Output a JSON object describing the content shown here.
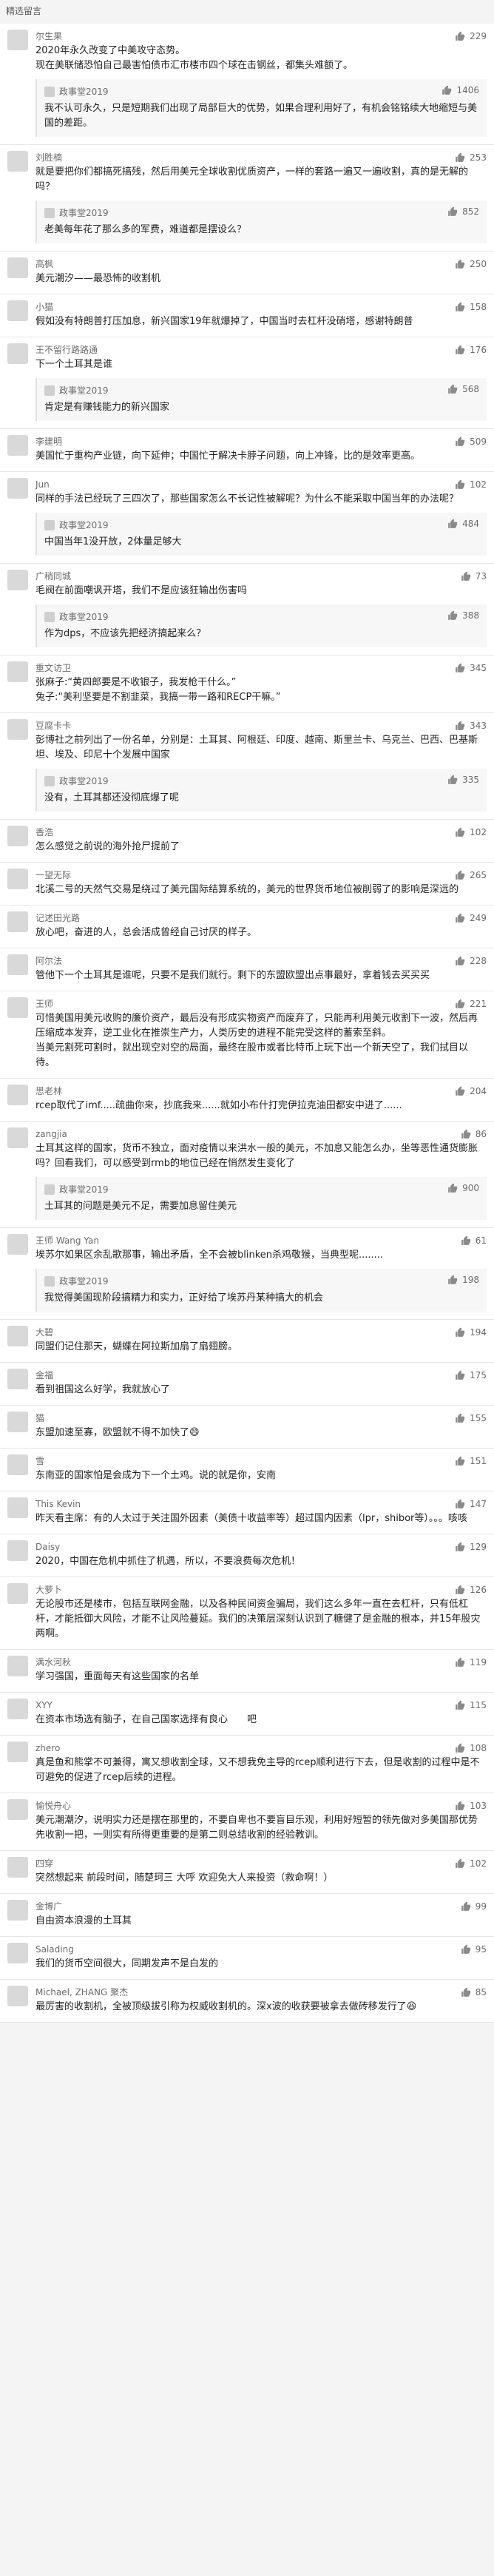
{
  "header": {
    "title": "精选留言"
  },
  "comments": [
    {
      "name": "尔生果",
      "likes": "229",
      "text": "2020年永久改变了中美攻守态势。\n现在美联储恐怕自己最害怕债市汇市楼市四个球在击钢丝，都集头难额了。",
      "reply": {
        "author": "政事堂2019",
        "likes": "1406",
        "text": "我不认可永久，只是短期我们出现了局部巨大的优势，如果合理利用好了，有机会铭铭续大地缩短与美国的差距。"
      }
    },
    {
      "name": "刘胜楠",
      "likes": "253",
      "text": "就是要把你们都搞死搞残，然后用美元全球收割优质资产，一样的套路一遍又一遍收割，真的是无解的吗？",
      "reply": {
        "author": "政事堂2019",
        "likes": "852",
        "text": "老美每年花了那么多的军费，难道都是摆设么？"
      }
    },
    {
      "name": "高枫",
      "likes": "250",
      "text": "美元潮汐——最恐怖的收割机",
      "reply": null
    },
    {
      "name": "小猫",
      "likes": "158",
      "text": "假如没有特朗普打压加息，新兴国家19年就爆掉了，中国当时去杠杆没硝塔，感谢特朗普",
      "reply": null
    },
    {
      "name": "王不留行路路通",
      "likes": "176",
      "text": "下一个土耳其是谁",
      "reply": {
        "author": "政事堂2019",
        "likes": "568",
        "text": "肯定是有赚钱能力的新兴国家"
      }
    },
    {
      "name": "李建明",
      "likes": "509",
      "text": "美国忙于重构产业链，向下延伸；中国忙于解决卡脖子问题，向上冲锋，比的是效率更高。",
      "reply": null
    },
    {
      "name": "Jun",
      "likes": "102",
      "text": "同样的手法已经玩了三四次了，那些国家怎么不长记性被解呢？为什么不能采取中国当年的办法呢？",
      "reply": {
        "author": "政事堂2019",
        "likes": "484",
        "text": "中国当年1没开放，2体量足够大"
      }
    },
    {
      "name": "广稍同城",
      "likes": "73",
      "text": "毛阀在前面嘲讽开塔，我们不是应该狂输出伤害吗",
      "reply": {
        "author": "政事堂2019",
        "likes": "388",
        "text": "作为dps，不应该先把经济搞起来么？"
      }
    },
    {
      "name": "重文访卫",
      "likes": "345",
      "text": "张麻子:“黄四郎要是不收银子，我发枪干什么。”\n兔子:“美利坚要是不割韭菜，我搞一带一路和RECP干嘛。”",
      "reply": null
    },
    {
      "name": "豆腐卡卡",
      "likes": "343",
      "text": "彭博社之前列出了一份名单，分别是：土耳其、阿根廷、印度、越南、斯里兰卡、乌克兰、巴西、巴基斯坦、埃及、印尼十个发展中国家",
      "reply": {
        "author": "政事堂2019",
        "likes": "335",
        "text": "没有，土耳其都还没彻底爆了呢"
      }
    },
    {
      "name": "香浩",
      "likes": "102",
      "text": "怎么感觉之前说的海外抢尸提前了",
      "reply": null
    },
    {
      "name": "一望无际",
      "likes": "265",
      "text": "北溪二号的天然气交易是绕过了美元国际结算系统的，美元的世界货币地位被削弱了的影响是深远的",
      "reply": null
    },
    {
      "name": "记述田光路",
      "likes": "249",
      "text": "放心吧，奋进的人，总会活成曾经自己讨厌的样子。",
      "reply": null
    },
    {
      "name": "阿尔法",
      "likes": "228",
      "text": "管他下一个土耳其是谁呢，只要不是我们就行。剩下的东盟欧盟出点事最好，拿着钱去买买买",
      "reply": null
    },
    {
      "name": "王师",
      "likes": "221",
      "text": "可惜美国用美元收购的廉价资产，最后没有形成实物资产而废弃了，只能再利用美元收割下一波，然后再压缩成本发弃，逆工业化在推崇生产力，人类历史的进程不能完受这样的蓄索至斜。\n当美元割死可割时，就出现空对空的局面，最终在股市或者比特币上玩下出一个新天空了，我们拭目以待。",
      "reply": null
    },
    {
      "name": "思老林",
      "likes": "204",
      "text": "rcep取代了imf.....疏曲你来，抄底我来......就如小布什打完伊拉克油田都安中进了......",
      "reply": null
    },
    {
      "name": "zangjia",
      "likes": "86",
      "text": "土耳其这样的国家，货币不独立，面对疫情以来洪水一般的美元，不加息又能怎么办，坐等恶性通货膨胀吗？回看我们，可以感受到rmb的地位已经在悄然发生变化了",
      "reply": {
        "author": "政事堂2019",
        "likes": "900",
        "text": "土耳其的问题是美元不足，需要加息留住美元"
      }
    },
    {
      "name": "王师 Wang Yan",
      "likes": "61",
      "text": "埃苏尔如果区余乱歌那事，输出矛盾，全不会被blinken杀鸡敬猴，当典型呢........",
      "reply": {
        "author": "政事堂2019",
        "likes": "198",
        "text": "我觉得美国现阶段搞精力和实力，正好给了埃苏丹某种搞大的机会"
      }
    },
    {
      "name": "大碧",
      "likes": "194",
      "text": "同盟们记住那天，蝴蝶在阿拉斯加扇了扇翅膀。",
      "reply": null
    },
    {
      "name": "金福",
      "likes": "175",
      "text": "看到祖国这么好学，我就放心了",
      "reply": null
    },
    {
      "name": "猫",
      "likes": "155",
      "text": "东盟加速至寡，欧盟就不得不加快了😄",
      "reply": null
    },
    {
      "name": "雪",
      "likes": "151",
      "text": "东南亚的国家怕是会成为下一个土鸡。说的就是你，安南",
      "reply": null
    },
    {
      "name": "This Kevin",
      "likes": "147",
      "text": "昨天看主席：有的人太过于关注国外因素（美债十收益率等）超过国内因素（lpr，shibor等）。。。咳咳",
      "reply": null
    },
    {
      "name": "Daisy",
      "likes": "129",
      "text": "2020，中国在危机中抓住了机遇，所以，不要浪费每次危机！",
      "reply": null
    },
    {
      "name": "大萝卜",
      "likes": "126",
      "text": "无论股市还是楼市，包括互联网金融，以及各种民间资金骗局，我们这么多年一直在去杠杆，只有低杠杆，才能抵御大风险，才能不让风险蔓延。我们的决策层深刻认识到了糖健了是金融的根本，并15年股灾两啊。",
      "reply": null
    },
    {
      "name": "满水河秋",
      "likes": "119",
      "text": "学习强国，重面每天有这些国家的名单",
      "reply": null
    },
    {
      "name": "XYY",
      "likes": "115",
      "text": "在资本市场选有脑子，在自己国家选择有良心　　吧",
      "reply": null
    },
    {
      "name": "zhero",
      "likes": "108",
      "text": "真是鱼和熊掌不可兼得，寓又想收割全球，又不想我免主导的rcep顺利进行下去，但是收割的过程中是不可避免的促进了rcep后续的进程。",
      "reply": null
    },
    {
      "name": "愉悦舟心",
      "likes": "103",
      "text": "美元潮潮汐，说明实力还是摆在那里的，不要自卑也不要盲目乐观，利用好短暂的领先做对多美国那优势先收割一把，一则实有所得更重要的是第二则总结收割的经验教训。",
      "reply": null
    },
    {
      "name": "四穿",
      "likes": "102",
      "text": "突然想起来 前段时间，随楚珂三 大呼 欢迎免大人来投资（救命啊！）",
      "reply": null
    },
    {
      "name": "金博广",
      "likes": "99",
      "text": "自由资本浪漫的土耳其",
      "reply": null
    },
    {
      "name": "Salading",
      "likes": "95",
      "text": "我们的货币空间很大，同期发声不是白发的",
      "reply": null
    },
    {
      "name": "Michael, ZHANG 聚杰",
      "likes": "85",
      "text": "最厉害的收割机，全被顶级拔引称为权威收割机的。深x波的收获要被拿去做砖移发行了😆",
      "reply": null
    }
  ]
}
